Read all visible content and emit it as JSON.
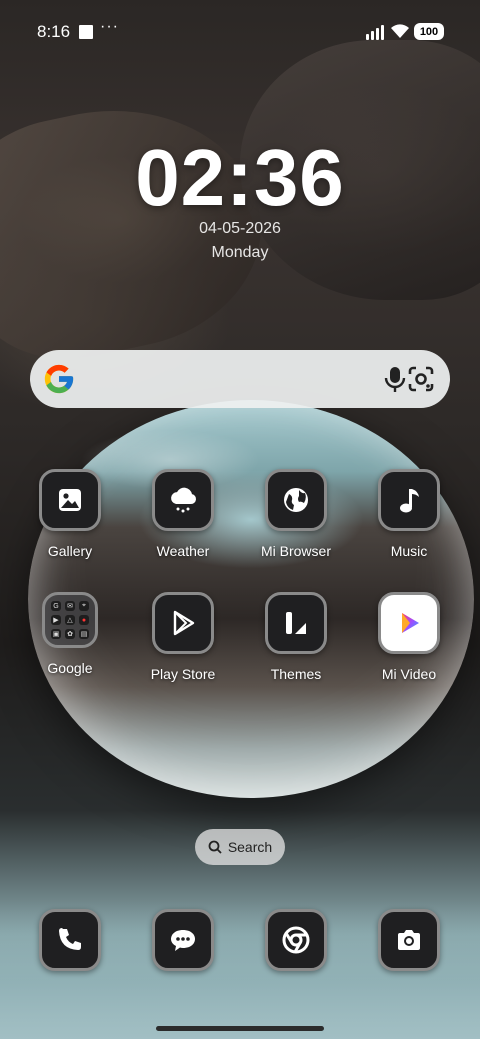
{
  "status_bar": {
    "time": "8:16",
    "more": "···",
    "battery": "100"
  },
  "lock": {
    "clock": "02:36",
    "date": "04-05-2026",
    "day": "Monday"
  },
  "search_bar": {
    "logo": "google-g-icon",
    "mic": "mic-icon",
    "lens": "lens-icon"
  },
  "apps_row1": [
    {
      "label": "Gallery",
      "icon": "gallery-icon"
    },
    {
      "label": "Weather",
      "icon": "weather-icon"
    },
    {
      "label": "Mi Browser",
      "icon": "globe-icon"
    },
    {
      "label": "Music",
      "icon": "music-note-icon"
    }
  ],
  "apps_row2": [
    {
      "label": "Google",
      "icon": "folder-icon"
    },
    {
      "label": "Play Store",
      "icon": "play-store-icon"
    },
    {
      "label": "Themes",
      "icon": "themes-icon"
    },
    {
      "label": "Mi Video",
      "icon": "mi-video-icon"
    }
  ],
  "search_pill": {
    "label": "Search"
  },
  "dock": [
    {
      "icon": "phone-icon"
    },
    {
      "icon": "messages-icon"
    },
    {
      "icon": "chrome-icon"
    },
    {
      "icon": "camera-icon"
    }
  ],
  "colors": {
    "icon_bg": "#1f1f21",
    "icon_border": "#8a8a8a"
  }
}
